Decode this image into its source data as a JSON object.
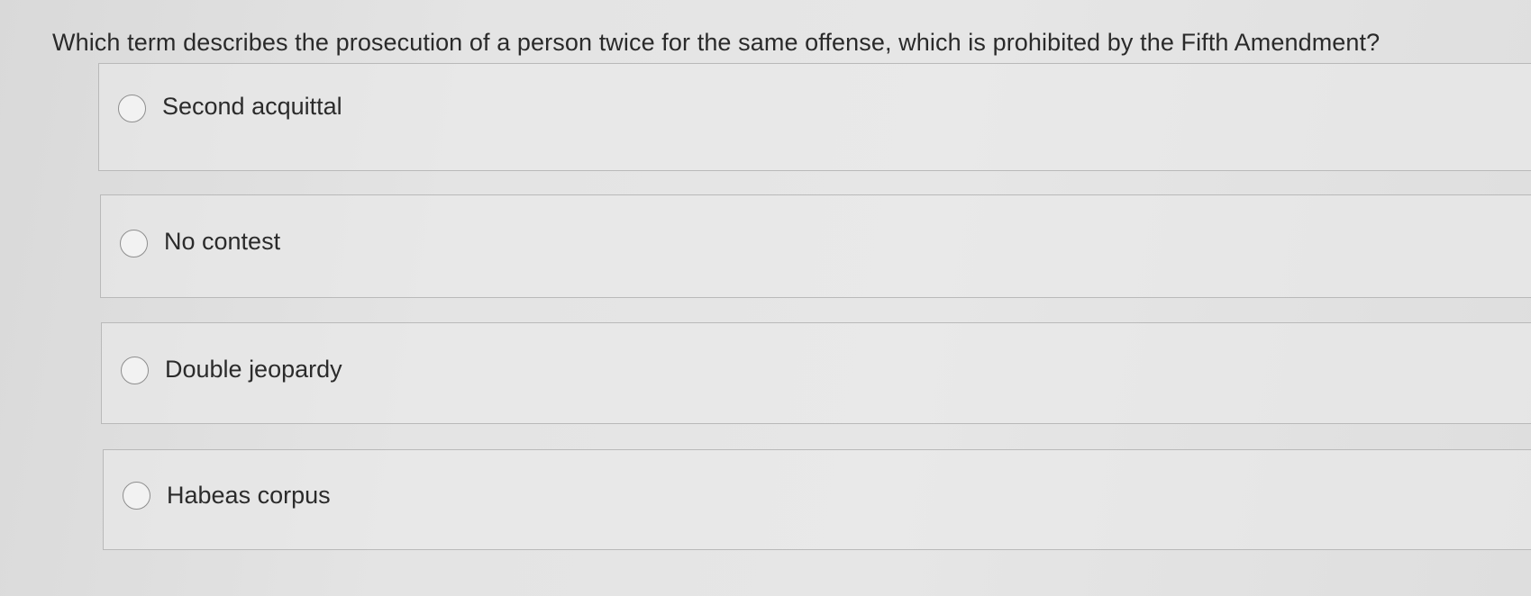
{
  "question": {
    "text": "Which term describes the prosecution of a person twice for the same offense, which is prohibited by the Fifth Amendment?"
  },
  "options": [
    {
      "label": "Second acquittal",
      "selected": false
    },
    {
      "label": "No contest",
      "selected": false
    },
    {
      "label": "Double jeopardy",
      "selected": false
    },
    {
      "label": "Habeas corpus",
      "selected": false
    }
  ]
}
